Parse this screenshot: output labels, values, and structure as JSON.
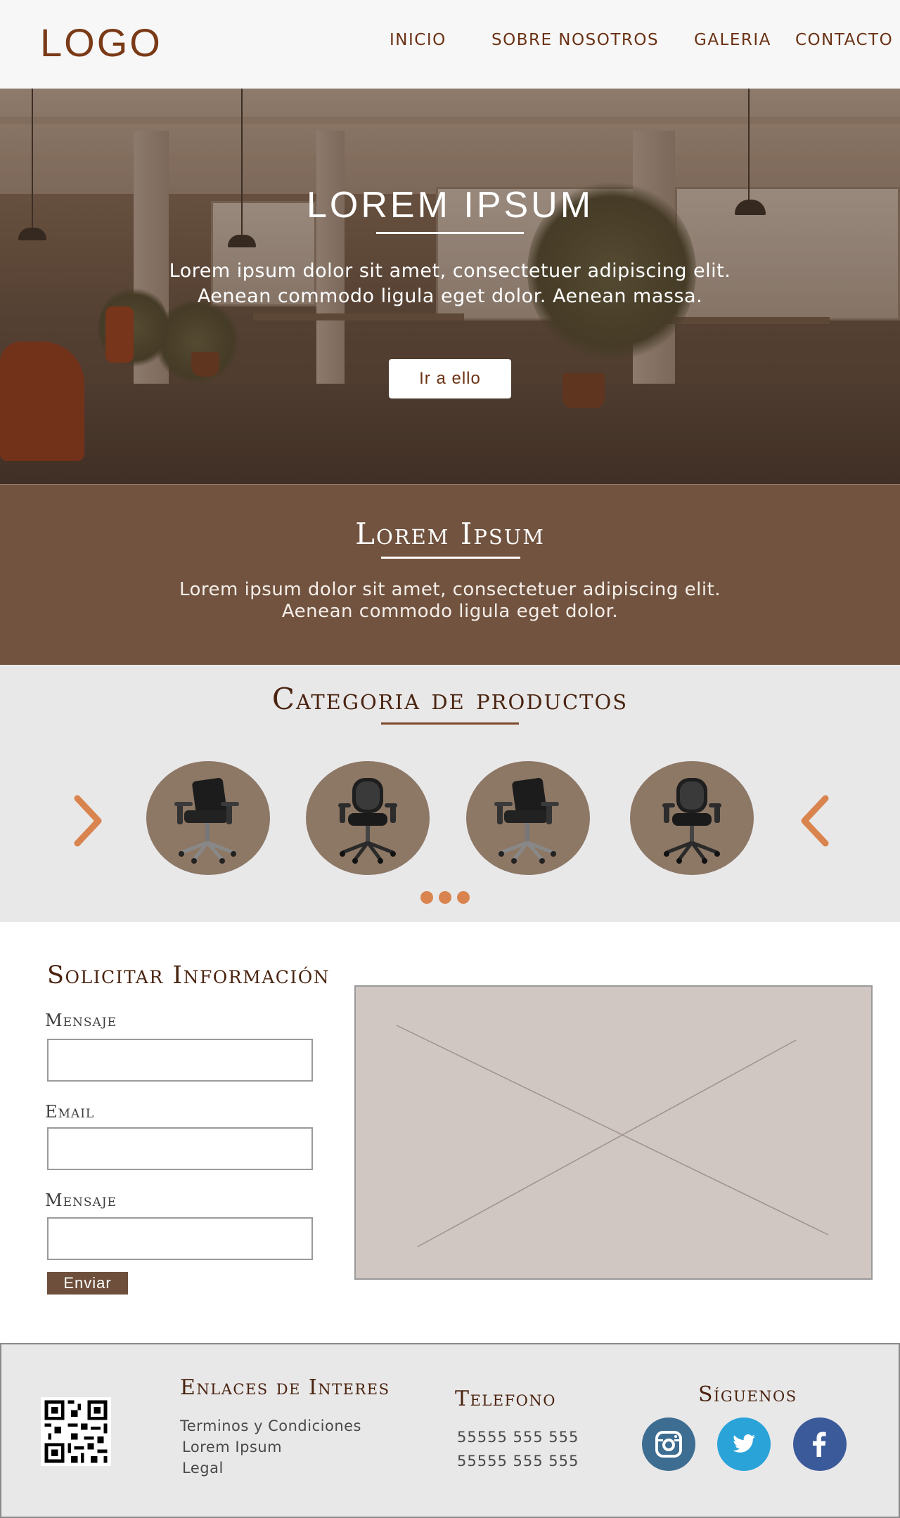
{
  "header": {
    "logo": "LOGO",
    "nav": [
      "INICIO",
      "SOBRE NOSOTROS",
      "GALERIA",
      "CONTACTO"
    ]
  },
  "hero": {
    "title": "LOREM IPSUM",
    "text": "Lorem ipsum dolor sit amet, consectetuer adipiscing elit. Aenean commodo ligula eget dolor. Aenean massa.",
    "button_label": "Ir a ello"
  },
  "about": {
    "title": "Lorem Ipsum",
    "text": "Lorem ipsum dolor sit amet, consectetuer adipiscing elit. Aenean commodo ligula eget dolor."
  },
  "categories": {
    "title": "Categoria de productos",
    "products": [
      "office-chair-icon",
      "mesh-office-chair-icon",
      "office-chair-icon",
      "mesh-office-chair-icon"
    ],
    "arrow_color": "#d9844e"
  },
  "form": {
    "title": "Solicitar Información",
    "fields": [
      {
        "label": "Mensaje",
        "value": ""
      },
      {
        "label": "Email",
        "value": ""
      },
      {
        "label": "Mensaje",
        "value": ""
      }
    ],
    "submit_label": "Enviar"
  },
  "footer": {
    "links_heading": "Enlaces de Interes",
    "links": [
      "Terminos y Condiciones",
      "Lorem Ipsum",
      "Legal"
    ],
    "phone_heading": "Telefono",
    "phones": [
      "55555 555 555",
      "55555 555 555"
    ],
    "social_heading": "Síguenos",
    "social": [
      {
        "icon": "instagram-icon",
        "color": "#3d6d91"
      },
      {
        "icon": "twitter-icon",
        "color": "#2aa3d9"
      },
      {
        "icon": "facebook-icon",
        "color": "#3a5a9a"
      }
    ]
  },
  "colors": {
    "brand_brown": "#72533f",
    "accent_orange": "#d9844e",
    "text_dark_brown": "#4a2410"
  }
}
